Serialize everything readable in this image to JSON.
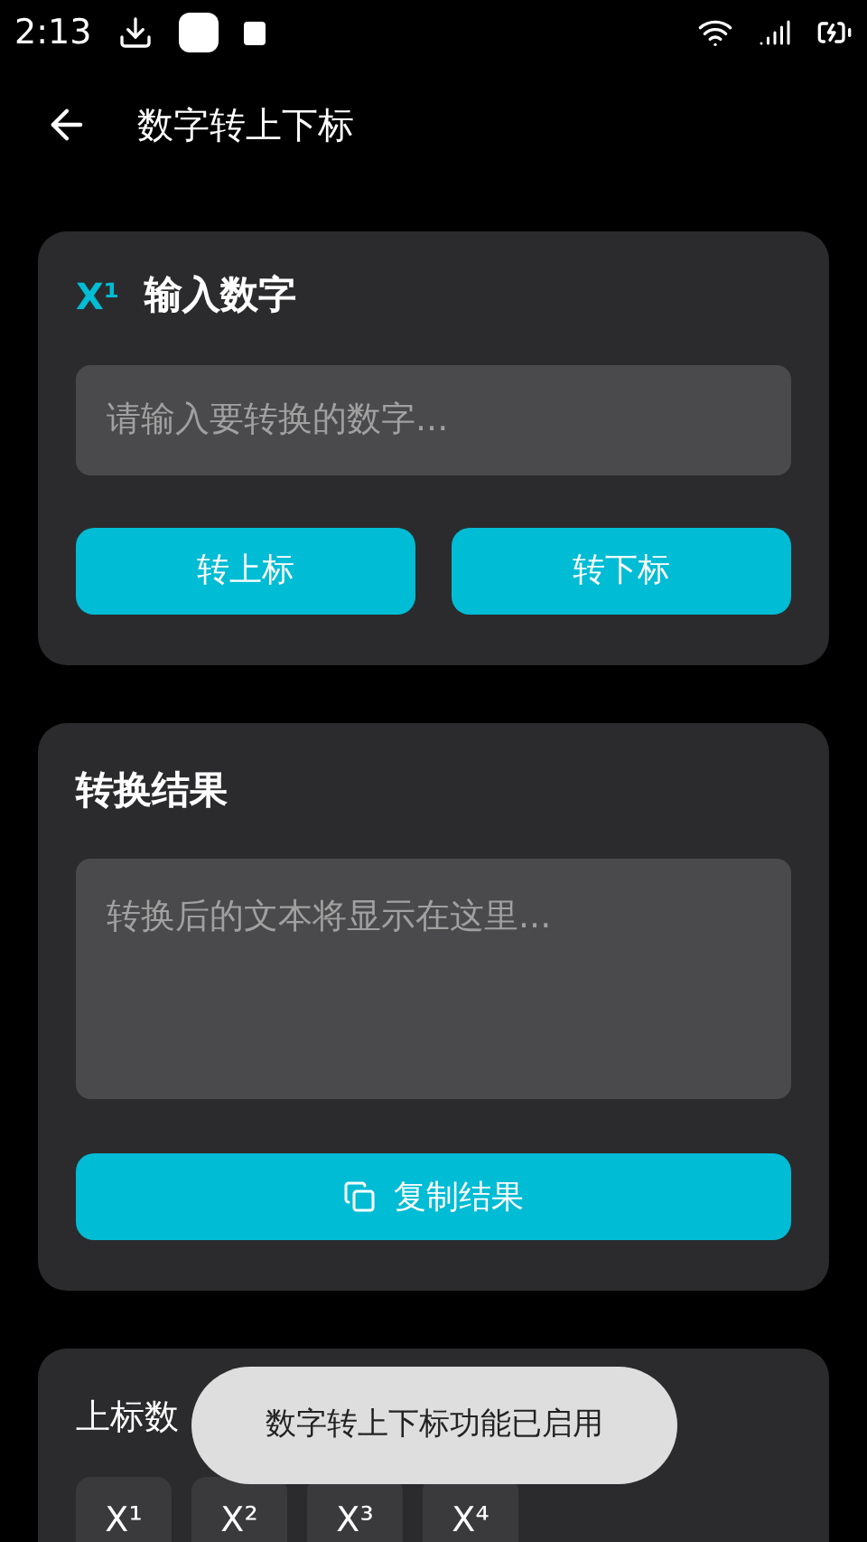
{
  "status_bar": {
    "time": "2:13"
  },
  "header": {
    "title": "数字转上下标"
  },
  "input_card": {
    "icon_text": "X¹",
    "title": "输入数字",
    "field": {
      "placeholder": "请输入要转换的数字..."
    },
    "buttons": [
      "转上标",
      "转下标"
    ]
  },
  "result_card": {
    "title": "转换结果",
    "output": {
      "placeholder": "转换后的文本将显示在这里..."
    },
    "copy_button": "复制结果"
  },
  "examples_card": {
    "title": "上标数",
    "chips": [
      "X¹",
      "X²",
      "X³",
      "X⁴"
    ]
  },
  "toast": "数字转上下标功能已启用"
}
